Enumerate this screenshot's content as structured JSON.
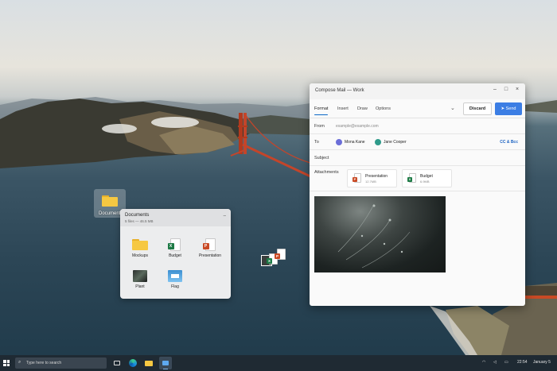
{
  "desktop": {
    "folder_label": "Documents"
  },
  "documents_flyout": {
    "title": "Documents",
    "subtitle": "5 files — 46.5 MB",
    "items": [
      {
        "label": "Mockups",
        "icon": "folder-icon"
      },
      {
        "label": "Budget",
        "icon": "excel-file-icon"
      },
      {
        "label": "Presentation",
        "icon": "powerpoint-file-icon"
      },
      {
        "label": "Plant",
        "icon": "image-thumbnail-icon"
      },
      {
        "label": "Flag",
        "icon": "image-thumbnail-icon"
      }
    ]
  },
  "mail": {
    "window_title": "Compose Mail — Work",
    "tabs": [
      "Format",
      "Insert",
      "Draw",
      "Options"
    ],
    "active_tab": "Format",
    "discard_label": "Discard",
    "send_label": "Send",
    "from_label": "From",
    "from_value": "example@example.com",
    "to_label": "To",
    "recipients": [
      {
        "name": "Mona Kane",
        "color": "#6b6ed8"
      },
      {
        "name": "Jane Cooper",
        "color": "#2f9a8a"
      }
    ],
    "cc_bcc_label": "CC & Bcc",
    "subject_label": "Subject",
    "attachments_label": "Attachments",
    "attachments": [
      {
        "name": "Presentation",
        "size": "12.7MB",
        "badge": "P",
        "color": "#c94a25"
      },
      {
        "name": "Budget",
        "size": "6.9MB",
        "badge": "X",
        "color": "#1d7a45"
      }
    ]
  },
  "taskbar": {
    "search_placeholder": "Type here to search",
    "time": "22:54",
    "date": "January 5"
  },
  "colors": {
    "accent": "#3c7ee4",
    "taskbar": "#1f2a33"
  }
}
